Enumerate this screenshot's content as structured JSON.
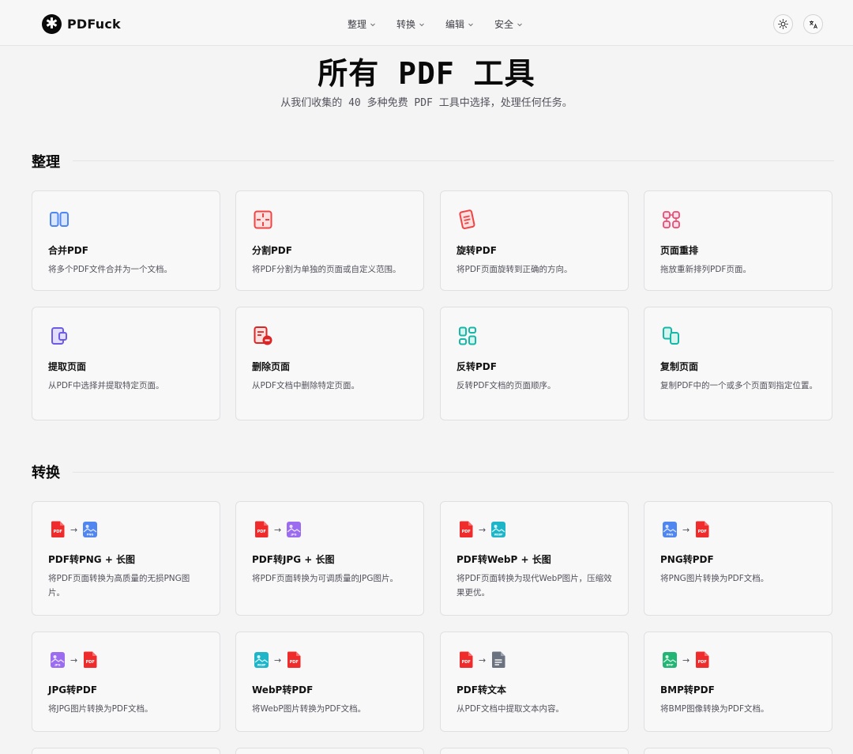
{
  "header": {
    "logo_text": "PDFuck",
    "nav": [
      "整理",
      "转换",
      "编辑",
      "安全"
    ]
  },
  "hero": {
    "title": "所有 PDF 工具",
    "subtitle": "从我们收集的 40 多种免费 PDF 工具中选择，处理任何任务。"
  },
  "sections": {
    "organize": {
      "title": "整理",
      "cards": [
        {
          "title": "合并PDF",
          "desc": "将多个PDF文件合并为一个文档。",
          "icon": "merge-icon"
        },
        {
          "title": "分割PDF",
          "desc": "将PDF分割为单独的页面或自定义范围。",
          "icon": "split-icon"
        },
        {
          "title": "旋转PDF",
          "desc": "将PDF页面旋转到正确的方向。",
          "icon": "rotate-icon"
        },
        {
          "title": "页面重排",
          "desc": "拖放重新排列PDF页面。",
          "icon": "reorder-icon"
        },
        {
          "title": "提取页面",
          "desc": "从PDF中选择并提取特定页面。",
          "icon": "extract-icon"
        },
        {
          "title": "删除页面",
          "desc": "从PDF文档中删除特定页面。",
          "icon": "delete-pages-icon"
        },
        {
          "title": "反转PDF",
          "desc": "反转PDF文档的页面顺序。",
          "icon": "reverse-icon"
        },
        {
          "title": "复制页面",
          "desc": "复制PDF中的一个或多个页面到指定位置。",
          "icon": "duplicate-icon"
        }
      ]
    },
    "convert": {
      "title": "转换",
      "cards": [
        {
          "title": "PDF转PNG + 长图",
          "desc": "将PDF页面转换为高质量的无损PNG图片。",
          "from": "PDF",
          "to": "PNG"
        },
        {
          "title": "PDF转JPG + 长图",
          "desc": "将PDF页面转换为可调质量的JPG图片。",
          "from": "PDF",
          "to": "JPG"
        },
        {
          "title": "PDF转WebP + 长图",
          "desc": "将PDF页面转换为现代WebP图片，压缩效果更优。",
          "from": "PDF",
          "to": "WEBP"
        },
        {
          "title": "PNG转PDF",
          "desc": "将PNG图片转换为PDF文档。",
          "from": "PNG",
          "to": "PDF"
        },
        {
          "title": "JPG转PDF",
          "desc": "将JPG图片转换为PDF文档。",
          "from": "JPG",
          "to": "PDF"
        },
        {
          "title": "WebP转PDF",
          "desc": "将WebP图片转换为PDF文档。",
          "from": "WEBP",
          "to": "PDF"
        },
        {
          "title": "PDF转文本",
          "desc": "从PDF文档中提取文本内容。",
          "from": "PDF",
          "to": "TXT"
        },
        {
          "title": "BMP转PDF",
          "desc": "将BMP图像转换为PDF文档。",
          "from": "BMP",
          "to": "PDF"
        }
      ]
    }
  },
  "colors": {
    "pdf_red": "#ef2b2b",
    "png_blue": "#4f86f0",
    "jpg_purple": "#9b6cf0",
    "webp_cyan": "#1fb5c8",
    "bmp_green": "#22b573",
    "txt_gray": "#6b7280"
  }
}
